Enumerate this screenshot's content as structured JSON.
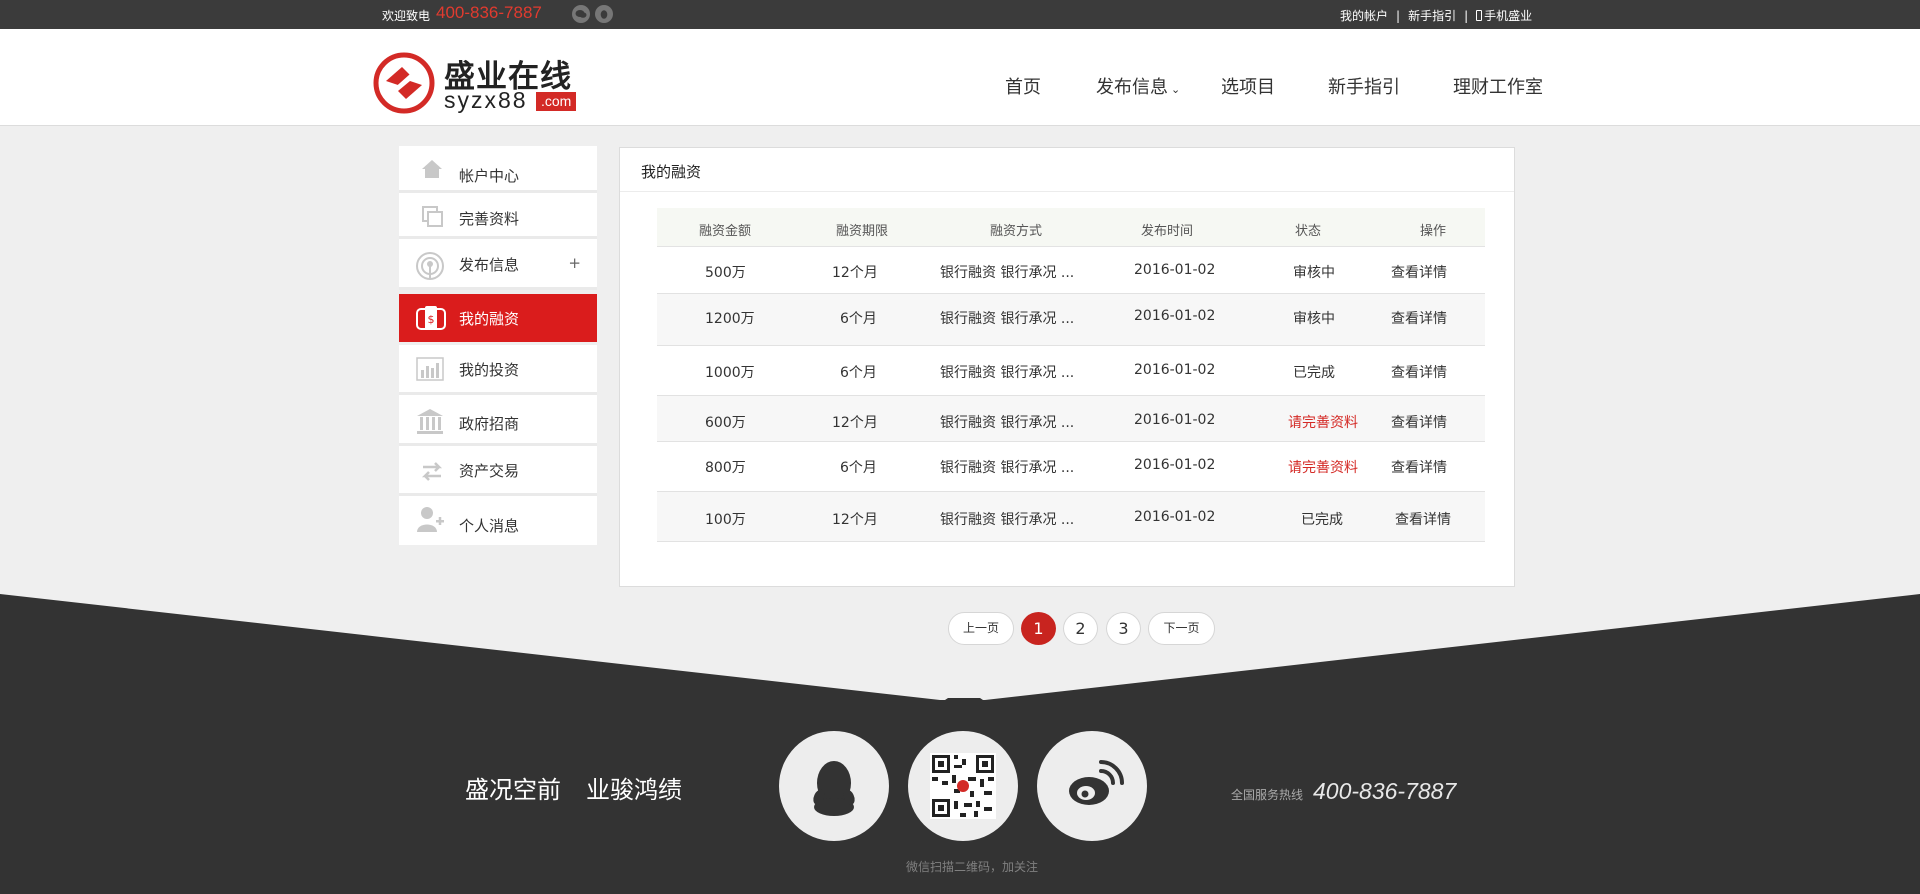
{
  "topbar": {
    "welcome": "欢迎致电",
    "hotline": "400-836-7887",
    "icons": [
      "wechat-icon",
      "qq-icon"
    ],
    "links": [
      "我的帐户",
      "新手指引",
      "手机盛业"
    ]
  },
  "header": {
    "logo_text": "盛业在线",
    "logo_domain": "syzx88",
    "logo_com": ".com",
    "nav": [
      "首页",
      "发布信息",
      "选项目",
      "新手指引",
      "理财工作室"
    ]
  },
  "sidebar": {
    "items": [
      {
        "label": "帐户中心",
        "icon": "home-icon"
      },
      {
        "label": "完善资料",
        "icon": "copy-icon"
      },
      {
        "label": "发布信息",
        "icon": "broadcast-icon",
        "expand": "+"
      },
      {
        "label": "我的融资",
        "icon": "financing-icon",
        "active": true
      },
      {
        "label": "我的投资",
        "icon": "bar-chart-icon"
      },
      {
        "label": "政府招商",
        "icon": "government-icon"
      },
      {
        "label": "资产交易",
        "icon": "exchange-icon"
      },
      {
        "label": "个人消息",
        "icon": "user-add-icon"
      }
    ]
  },
  "main": {
    "title": "我的融资",
    "columns": [
      "融资金额",
      "融资期限",
      "融资方式",
      "发布时间",
      "状态",
      "操作"
    ],
    "rows": [
      {
        "amount": "500万",
        "term": "12个月",
        "method": "银行融资   银行承况 ...",
        "date": "2016-01-02",
        "status": "审核中",
        "status_color": "#333333",
        "action": "查看详情"
      },
      {
        "amount": "1200万",
        "term": "6个月",
        "method": "银行融资   银行承况 ...",
        "date": "2016-01-02",
        "status": "审核中",
        "status_color": "#333333",
        "action": "查看详情"
      },
      {
        "amount": "1000万",
        "term": "6个月",
        "method": "银行融资   银行承况 ...",
        "date": "2016-01-02",
        "status": "已完成",
        "status_color": "#333333",
        "action": "查看详情"
      },
      {
        "amount": "600万",
        "term": "12个月",
        "method": "银行融资   银行承况 ...",
        "date": "2016-01-02",
        "status": "请完善资料",
        "status_color": "#d42a26",
        "action": "查看详情"
      },
      {
        "amount": "800万",
        "term": "6个月",
        "method": "银行融资   银行承况 ...",
        "date": "2016-01-02",
        "status": "请完善资料",
        "status_color": "#d42a26",
        "action": "查看详情"
      },
      {
        "amount": "100万",
        "term": "12个月",
        "method": "银行融资   银行承况 ...",
        "date": "2016-01-02",
        "status": "已完成",
        "status_color": "#333333",
        "action": "查看详情"
      }
    ]
  },
  "pagination": {
    "prev": "上一页",
    "pages": [
      "1",
      "2",
      "3"
    ],
    "current": "1",
    "next": "下一页"
  },
  "footer": {
    "slogan_1": "盛况空前",
    "slogan_2": "业骏鸿绩",
    "social_icons": [
      "qq-icon",
      "qr-code-icon",
      "weibo-icon"
    ],
    "qr_caption": "微信扫描二维码，加关注",
    "hotline_label": "全国服务热线",
    "hotline": "400-836-7887"
  },
  "colors": {
    "accent_red": "#da1c1c",
    "dark_bg": "#3b3b3b",
    "page_bg": "#efefef"
  }
}
